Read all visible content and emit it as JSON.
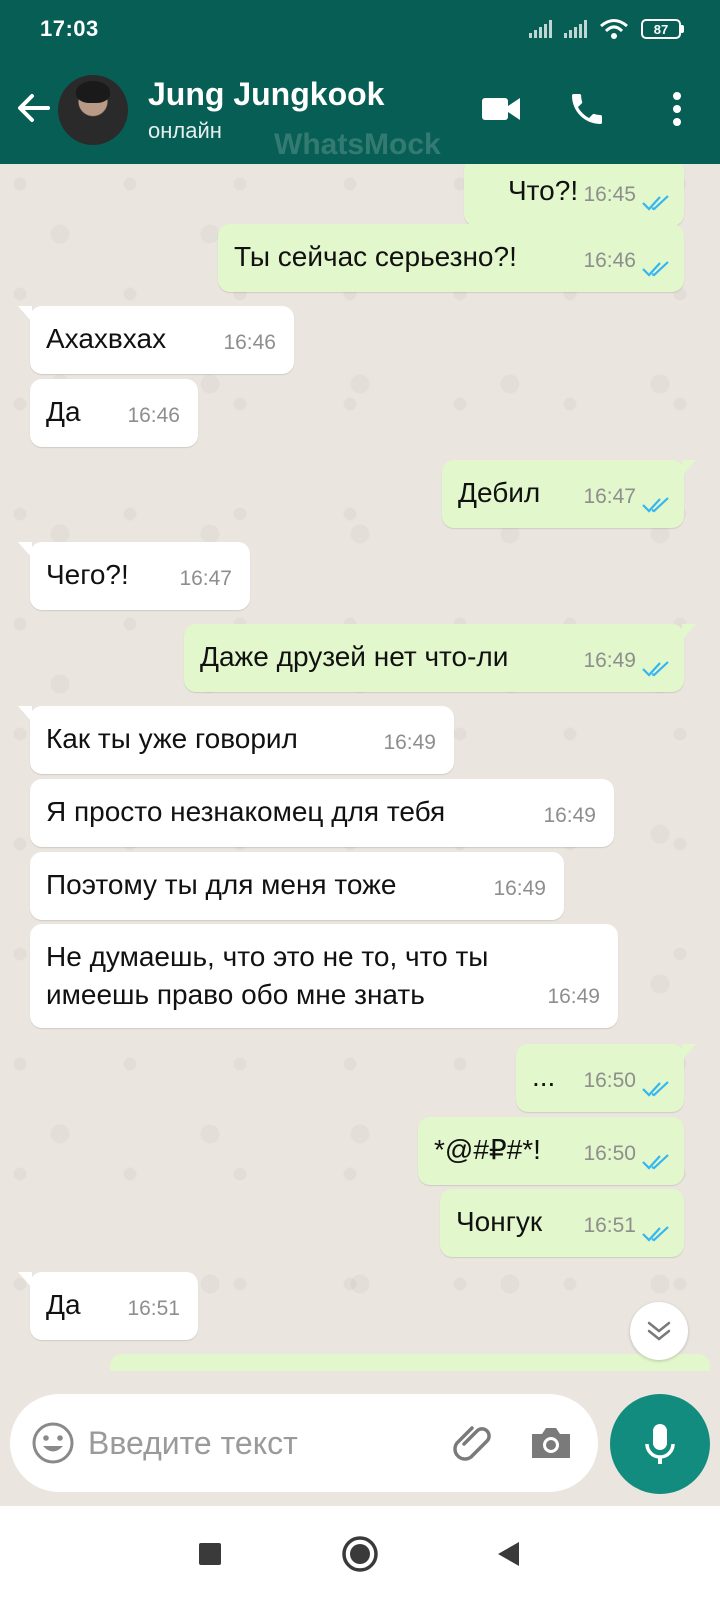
{
  "status_bar": {
    "time": "17:03",
    "battery": "87"
  },
  "header": {
    "contact_name": "Jung Jungkook",
    "contact_status": "онлайн",
    "watermark": "WhatsMock"
  },
  "messages": [
    {
      "dir": "out",
      "text": "Что?!",
      "time": "16:45",
      "read": true
    },
    {
      "dir": "out",
      "text": "Ты сейчас серьезно?!",
      "time": "16:46",
      "read": true
    },
    {
      "dir": "in",
      "text": "Ахахвхах",
      "time": "16:46"
    },
    {
      "dir": "in",
      "text": "Да",
      "time": "16:46"
    },
    {
      "dir": "out",
      "text": "Дебил",
      "time": "16:47",
      "read": true
    },
    {
      "dir": "in",
      "text": "Чего?!",
      "time": "16:47"
    },
    {
      "dir": "out",
      "text": "Даже друзей нет что-ли",
      "time": "16:49",
      "read": true
    },
    {
      "dir": "in",
      "text": "Как ты уже говорил",
      "time": "16:49"
    },
    {
      "dir": "in",
      "text": "Я просто незнакомец для тебя",
      "time": "16:49"
    },
    {
      "dir": "in",
      "text": "Поэтому ты для меня тоже",
      "time": "16:49"
    },
    {
      "dir": "in",
      "text": "Не думаешь, что это не то, что ты имеешь право обо мне знать",
      "time": "16:49"
    },
    {
      "dir": "out",
      "text": "...",
      "time": "16:50",
      "read": true
    },
    {
      "dir": "out",
      "text": "*@#₽#*!",
      "time": "16:50",
      "read": true
    },
    {
      "dir": "out",
      "text": "Чонгук",
      "time": "16:51",
      "read": true
    },
    {
      "dir": "in",
      "text": "Да",
      "time": "16:51"
    }
  ],
  "input": {
    "placeholder": "Введите текст"
  },
  "colors": {
    "header": "#075e54",
    "outgoing_bubble": "#e2f7cb",
    "incoming_bubble": "#ffffff",
    "read_ticks": "#34b7f1",
    "mic_button": "#128c7e"
  },
  "icons": {
    "back": "arrow-left-icon",
    "video": "video-camera-icon",
    "call": "phone-icon",
    "menu": "more-vertical-icon",
    "emoji": "emoji-icon",
    "attach": "paperclip-icon",
    "camera": "camera-icon",
    "mic": "microphone-icon",
    "scroll": "chevron-double-down-icon"
  }
}
